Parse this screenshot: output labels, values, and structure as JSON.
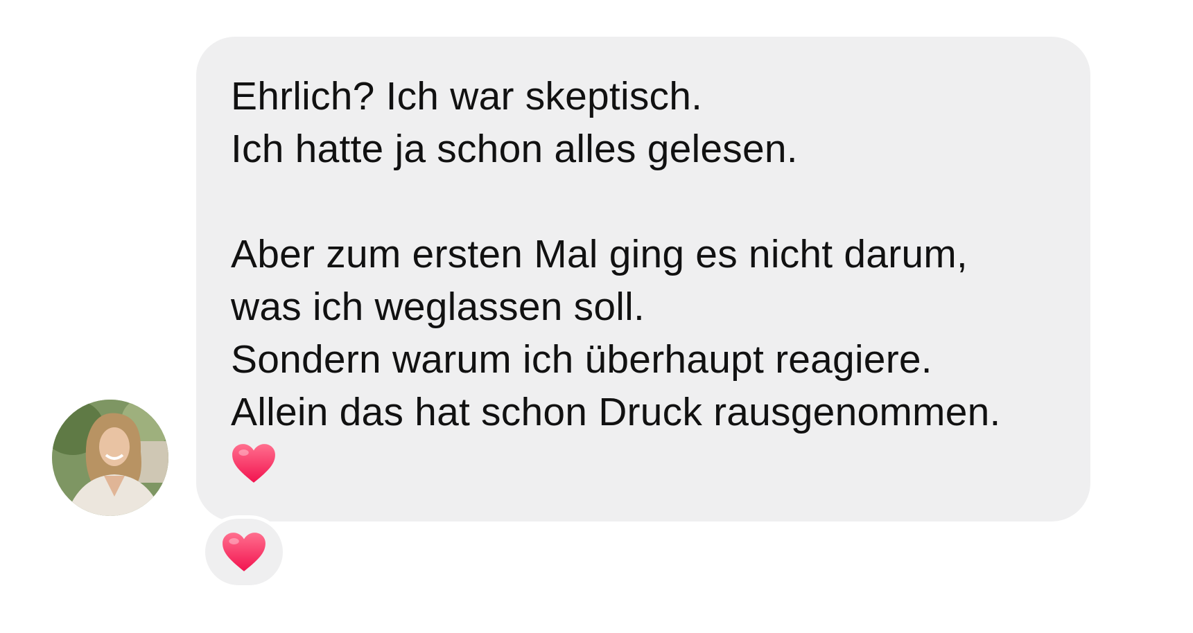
{
  "message": {
    "lines": [
      "Ehrlich? Ich war skeptisch.",
      "Ich hatte ja schon alles gelesen.",
      "Aber zum ersten Mal ging es nicht darum,",
      "was ich weglassen soll.",
      "Sondern warum ich überhaupt reagiere.",
      "Allein das hat schon Druck rausgenommen."
    ],
    "inline_emoji": "heart-icon"
  },
  "reaction": {
    "emoji": "heart-icon"
  },
  "colors": {
    "bubble_bg": "#efeff0",
    "text": "#111111",
    "heart": "#ff2d55"
  }
}
